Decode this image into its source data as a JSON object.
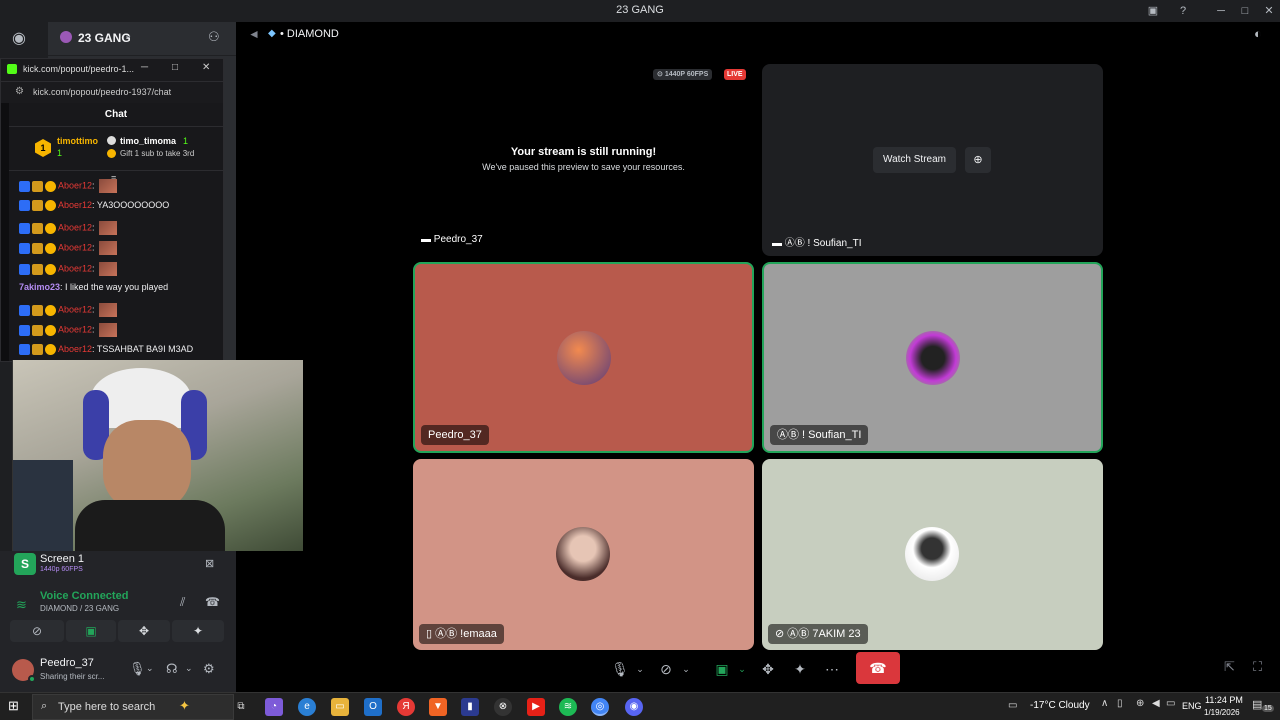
{
  "window": {
    "title": "23 GANG"
  },
  "server": {
    "name": "23 GANG"
  },
  "popout": {
    "title": "kick.com/popout/peedro-1...",
    "url": "kick.com/popout/peedro-1937/chat",
    "chat_header": "Chat",
    "pinned": {
      "user1": "timottimo",
      "user1_count": "1",
      "user1_sub": "1",
      "user2": "timo_timoma",
      "user2_count": "1",
      "gift_text": "Gift 1 sub to take 3rd"
    },
    "messages": [
      {
        "user": "Aboer12",
        "text": ""
      },
      {
        "user": "Aboer12",
        "text": "YA3OOOOOOOO"
      },
      {
        "user": "Aboer12",
        "text": ""
      },
      {
        "user": "Aboer12",
        "text": ""
      },
      {
        "user": "Aboer12",
        "text": ""
      },
      {
        "user": "7akimo23",
        "text": "I liked the way you played"
      },
      {
        "user": "Aboer12",
        "text": ""
      },
      {
        "user": "Aboer12",
        "text": ""
      },
      {
        "user": "Aboer12",
        "text": "TSSAHBAT BA9I M3AD"
      }
    ]
  },
  "voice": {
    "screen_title": "Screen 1",
    "screen_quality": "1440p 60FPS",
    "status": "Voice Connected",
    "channel": "DIAMOND / 23 GANG"
  },
  "user": {
    "name": "Peedro_37",
    "status": "Sharing their scr..."
  },
  "main": {
    "channel_name": "DIAMOND",
    "stream_quality": "1440P 60FPS",
    "live_label": "LIVE",
    "stream_title": "Your stream is still running!",
    "stream_subtitle": "We've paused this preview to save your resources.",
    "stream_owner": "Peedro_37",
    "watch_stream_label": "Watch Stream",
    "second_stream_owner": "ⒶⒷ ! Soufian_TI",
    "tiles": [
      {
        "name": "Peedro_37",
        "bg": "#b85a4c"
      },
      {
        "name": "ⒶⒷ ! Soufian_TI",
        "bg": "#9e9e9e"
      },
      {
        "name": "ⒶⒷ !emaaa",
        "bg": "#d29486"
      },
      {
        "name": "ⒶⒷ 7AKIM 23",
        "bg": "#c7cebf"
      }
    ]
  },
  "taskbar": {
    "search_placeholder": "Type here to search",
    "weather": "-17°C  Cloudy",
    "lang": "ENG",
    "time": "11:24 PM",
    "date": "1/19/2026",
    "notif_count": "15"
  },
  "colors": {
    "accent_green": "#23a55a",
    "live_red": "#e53935",
    "end_call": "#da373c",
    "kick_green": "#53fc18"
  }
}
